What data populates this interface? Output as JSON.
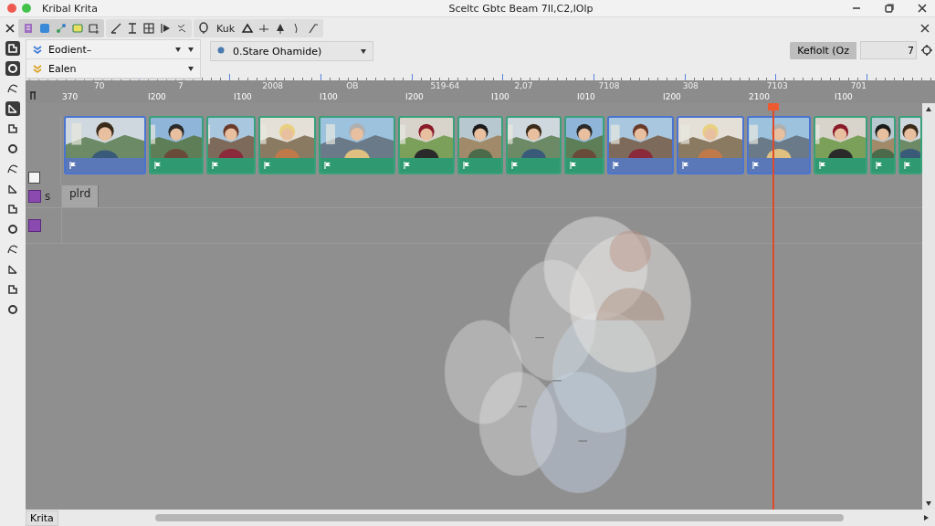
{
  "title_bar": {
    "app_name": "Kribal Krita",
    "document_title": "Sceltc Gbtc Beam 7Il,C2,lOlp"
  },
  "toolbar": {
    "label": "Kuk"
  },
  "tool_options": [
    {
      "value": "Eodient–"
    },
    {
      "value": "Ealen"
    }
  ],
  "layer_dropdown": {
    "value": "0.Stare Ohamide)"
  },
  "frame_field": {
    "label": "Kefiolt (Oz",
    "value": "7"
  },
  "left_tools": [
    {
      "selected": true
    },
    {
      "selected": true
    },
    {
      "selected": false
    },
    {
      "selected": true
    },
    {
      "selected": false
    },
    {
      "selected": false
    },
    {
      "selected": false
    },
    {
      "selected": false
    },
    {
      "selected": false
    },
    {
      "selected": false
    },
    {
      "selected": false
    },
    {
      "selected": false
    },
    {
      "selected": false
    },
    {
      "selected": false
    }
  ],
  "ruler": {
    "top_labels": [
      "70",
      "7",
      "2008",
      "OB",
      "519-64",
      "2,07",
      "7108",
      "308",
      "7103",
      "701"
    ],
    "bottom_labels": [
      "370",
      "I200",
      "I100",
      "I100",
      "I200",
      "I100",
      "I010",
      "I200",
      "2100",
      "I100"
    ]
  },
  "clips": [
    {
      "selected": true
    },
    {
      "selected": false
    },
    {
      "selected": false
    },
    {
      "selected": false
    },
    {
      "selected": false
    },
    {
      "selected": false
    },
    {
      "selected": false
    },
    {
      "selected": false
    },
    {
      "selected": false
    },
    {
      "selected": true
    },
    {
      "selected": true
    },
    {
      "selected": true
    },
    {
      "selected": false
    },
    {
      "selected": false
    },
    {
      "selected": false
    }
  ],
  "layers": [
    {
      "name": "s",
      "tab": "plrd"
    }
  ],
  "status_bar": {
    "label": "Krita"
  }
}
